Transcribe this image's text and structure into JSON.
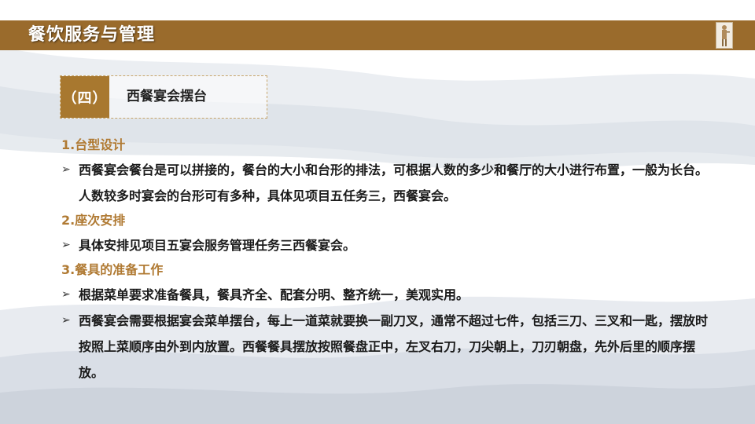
{
  "header": {
    "title": "餐饮服务与管理"
  },
  "section": {
    "number": "（四）",
    "title": "西餐宴会摆台"
  },
  "content": {
    "headings": [
      "1.台型设计",
      "2.座次安排",
      "3.餐具的准备工作"
    ],
    "bullets": [
      "西餐宴会餐台是可以拼接的，餐台的大小和台形的排法，可根据人数的多少和餐厅的大小进行布置，一般为长台。人数较多时宴会的台形可有多种，具体见项目五任务三，西餐宴会。",
      "具体安排见项目五宴会服务管理任务三西餐宴会。",
      "根据菜单要求准备餐具，餐具齐全、配套分明、整齐统一，美观实用。",
      "西餐宴会需要根据宴会菜单摆台，每上一道菜就要换一副刀叉，通常不超过七件，包括三刀、三叉和一匙，摆放时按照上菜顺序由外到内放置。西餐餐具摆放按照餐盘正中，左叉右刀，刀尖朝上，刀刃朝盘，先外后里的顺序摆放。"
    ],
    "bullet_icon": "arrow-bullet-icon"
  },
  "colors": {
    "header_bar": "#9a6b2c",
    "accent": "#b07a33",
    "section_number_bg": "#a8782f"
  }
}
